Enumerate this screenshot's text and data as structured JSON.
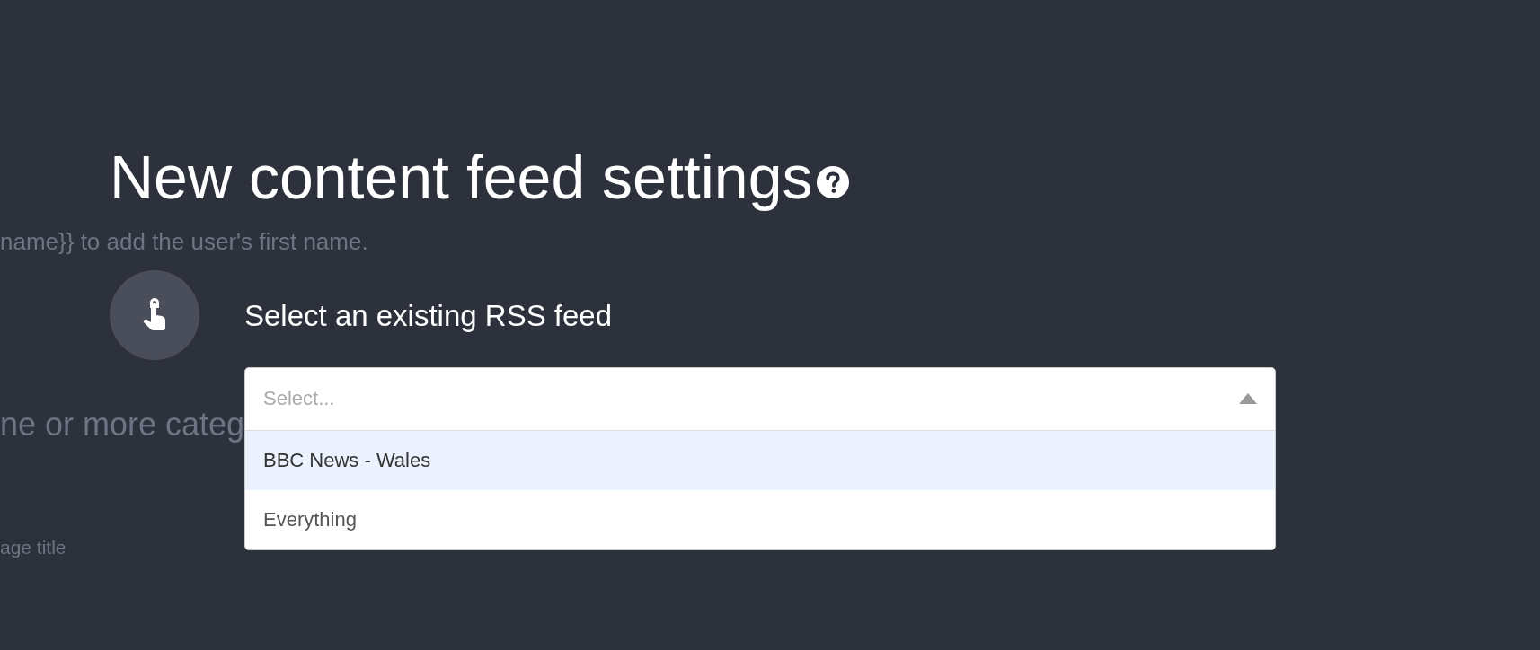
{
  "background": {
    "lines": [
      {
        "kind": "body",
        "text": "name}} to add the user's first name."
      },
      {
        "kind": "heading",
        "text": "ne or more categ"
      },
      {
        "kind": "label",
        "text": "age title"
      }
    ]
  },
  "modal": {
    "title": "New content feed settings",
    "field_label": "Select an existing RSS feed",
    "select": {
      "placeholder": "Select...",
      "expanded": true,
      "options": [
        {
          "label": "BBC News - Wales",
          "selected": true
        },
        {
          "label": "Everything",
          "selected": false
        }
      ]
    }
  }
}
